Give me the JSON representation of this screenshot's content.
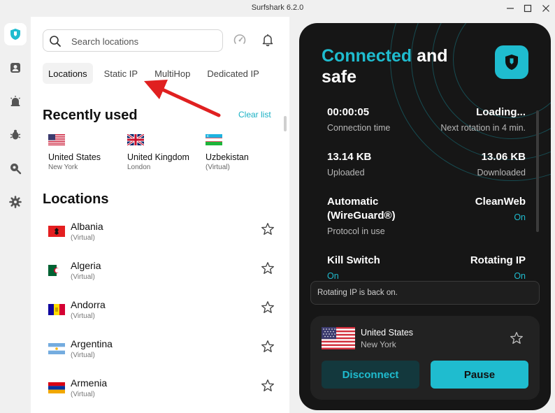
{
  "window": {
    "title": "Surfshark 6.2.0"
  },
  "search": {
    "placeholder": "Search locations"
  },
  "tabs": [
    {
      "label": "Locations"
    },
    {
      "label": "Static IP"
    },
    {
      "label": "MultiHop"
    },
    {
      "label": "Dedicated IP"
    }
  ],
  "recent": {
    "title": "Recently used",
    "clear_label": "Clear list",
    "items": [
      {
        "name": "United States",
        "sub": "New York",
        "flag": "flag-us-icon"
      },
      {
        "name": "United Kingdom",
        "sub": "London",
        "flag": "flag-uk-icon"
      },
      {
        "name": "Uzbekistan",
        "sub": "(Virtual)",
        "flag": "flag-uz-icon"
      }
    ]
  },
  "locations": {
    "title": "Locations",
    "items": [
      {
        "name": "Albania",
        "sub": "(Virtual)"
      },
      {
        "name": "Algeria",
        "sub": "(Virtual)"
      },
      {
        "name": "Andorra",
        "sub": "(Virtual)"
      },
      {
        "name": "Argentina",
        "sub": "(Virtual)"
      },
      {
        "name": "Armenia",
        "sub": "(Virtual)"
      }
    ]
  },
  "status": {
    "accent": "Connected",
    "rest": " and safe"
  },
  "stats": {
    "time_value": "00:00:05",
    "time_label": "Connection time",
    "rotation_value": "Loading...",
    "rotation_label": "Next rotation in 4 min.",
    "uploaded_value": "13.14 KB",
    "uploaded_label": "Uploaded",
    "downloaded_value": "13.06 KB",
    "downloaded_label": "Downloaded",
    "protocol_value_1": "Automatic",
    "protocol_value_2": "(WireGuard®)",
    "protocol_label": "Protocol in use",
    "cleanweb_value": "CleanWeb",
    "cleanweb_state": "On",
    "killswitch_value": "Kill Switch",
    "killswitch_state": "On",
    "rotating_value": "Rotating IP",
    "rotating_state": "On"
  },
  "toast": {
    "text": "Rotating IP is back on."
  },
  "current": {
    "name": "United States",
    "sub": "New York"
  },
  "actions": {
    "disconnect": "Disconnect",
    "pause": "Pause"
  },
  "colors": {
    "accent": "#1fbccf",
    "card": "#161616",
    "annotation": "#e02020"
  }
}
